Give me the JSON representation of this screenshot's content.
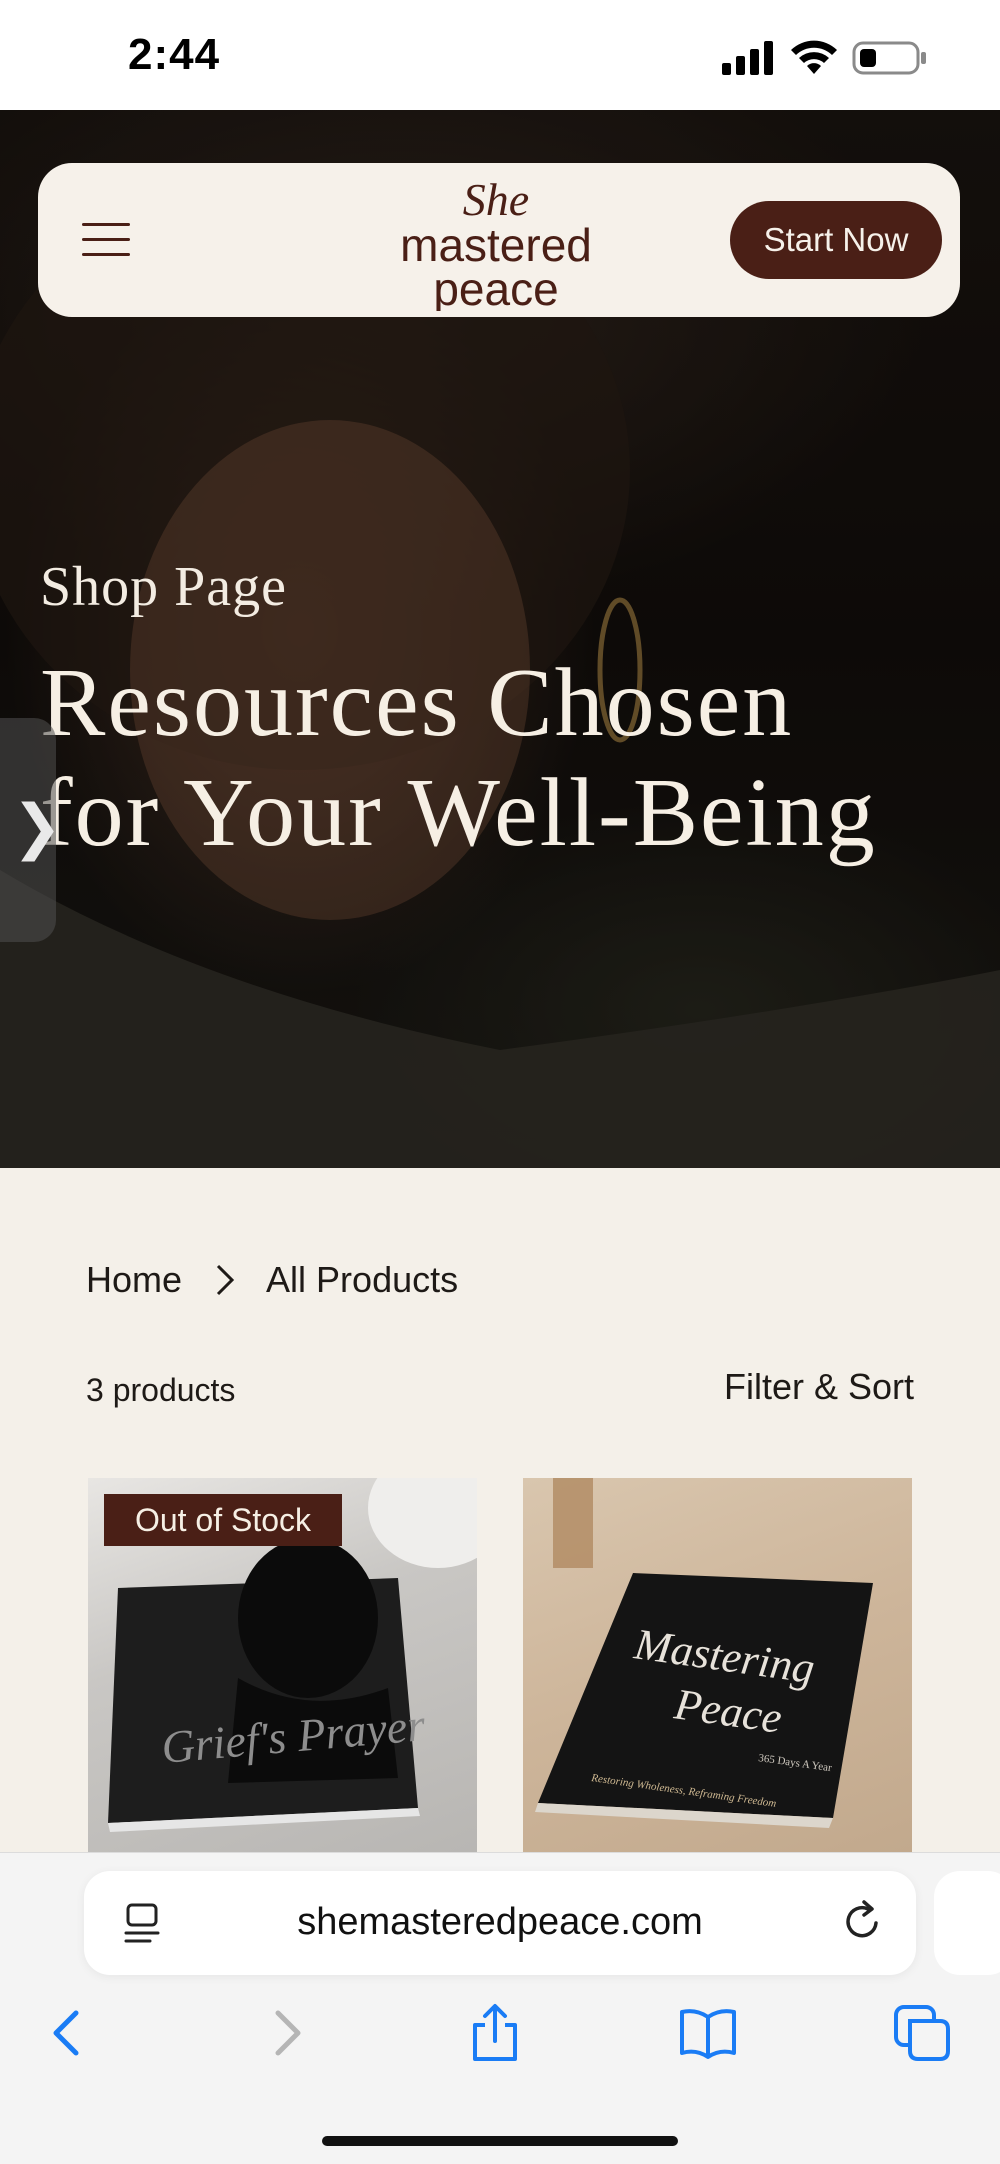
{
  "status": {
    "time": "2:44",
    "icons": [
      "signal-icon",
      "wifi-icon",
      "battery-icon"
    ]
  },
  "nav": {
    "menu_icon": "hamburger-menu-icon",
    "logo_lines": [
      "She",
      "mastered",
      "peace"
    ],
    "cta_label": "Start Now"
  },
  "hero": {
    "eyebrow": "Shop Page",
    "title_line1": "Resources Chosen",
    "title_line2": "for Your Well-Being",
    "side_tab_glyph": "❯"
  },
  "breadcrumb": {
    "home": "Home",
    "current": "All Products"
  },
  "products": {
    "count": "3 products",
    "filter_label": "Filter & Sort",
    "items": [
      {
        "badge": "Out of Stock",
        "book_title": "Grief's Prayer"
      },
      {
        "book_title_1": "Mastering",
        "book_title_2": "Peace",
        "book_subtitle": "365 Days A Year",
        "book_tagline": "Restoring Wholeness, Reframing Freedom"
      }
    ]
  },
  "browser": {
    "url": "shemasteredpeace.com",
    "icons": [
      "back-icon",
      "forward-icon",
      "share-icon",
      "bookmarks-icon",
      "tabs-icon"
    ]
  },
  "colors": {
    "brand": "#4a1f16",
    "cream": "#f6f1ea",
    "page_bg": "#f4f0e9",
    "link_blue": "#1a7cf5"
  }
}
